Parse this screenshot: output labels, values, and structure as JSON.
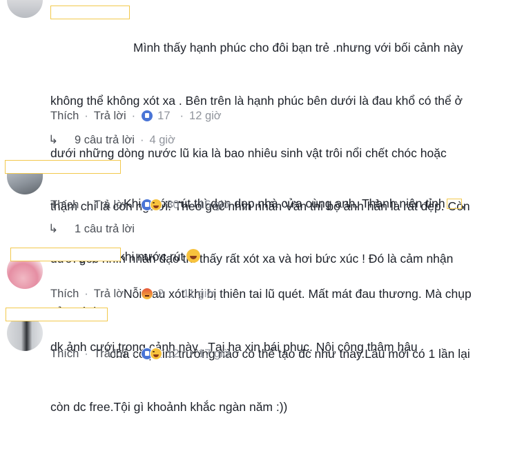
{
  "comments": [
    {
      "text_lines": [
        "Mình thấy hạnh phúc cho đôi bạn trẻ .nhưng với bối cảnh này",
        "không thể không xót xa . Bên trên là hạnh phúc bên dưới là đau khổ có thể ở",
        "dưới những dòng nước lũ kia là bao nhiêu sinh vật trôi nổi chết chóc hoặc",
        "thậm chí là con người. Theo góc nhìn nhân Văn thì bộ ảnh hẳn là rất đẹp. Còn",
        "dưới góc nhìn nhân đạo thì thấy rất xót xa và hơi bức xúc ! Đó là cảm nhận",
        "của mình!"
      ],
      "like_label": "Thích",
      "reply_label": "Trả lời",
      "reaction_count": "17",
      "time": "12 giờ",
      "replies_label": "9 câu trả lời",
      "replies_time": "4 giờ"
    },
    {
      "text_lines": [
        "Khi nước rút thì dọn dẹp nhà cửa cùng anh. Thanh niên tỉnh",
        "cưới gấp trc khi nước rút"
      ],
      "trailing_punct": ",",
      "like_label": "Thích",
      "reply_label": "Trả lời",
      "reaction_count": "30",
      "time": "16 giờ",
      "replies_label": "1 câu trả lời"
    },
    {
      "text_lines": [
        "Nỗi đau xót khi bị thiên tai lũ quét. Mất mát đau thương. Mà chụp",
        "dk ảnh cưới trong cảnh này . Tại hạ xin bái phục. Nội công thâm hậu"
      ],
      "like_label": "Thích",
      "reply_label": "Trả lời",
      "reaction_count": "2",
      "time": "11 giờ"
    },
    {
      "text_lines": [
        "chả có phim trường nào có thể tạo đc như tnay.Lâu mới có 1 lần lại",
        "còn dc free.Tội gì khoảnh khắc ngàn năm :))"
      ],
      "like_label": "Thích",
      "reply_label": "Trả lời",
      "reaction_count": "12",
      "time": "17 giờ"
    }
  ],
  "symbols": {
    "dot": "·",
    "reply_arrow": "↳"
  },
  "colors": {
    "link_gray": "#4b4f56",
    "meta_gray": "#90949c",
    "like_blue": "#4a75d6",
    "name_box_border": "#f2c84b"
  }
}
